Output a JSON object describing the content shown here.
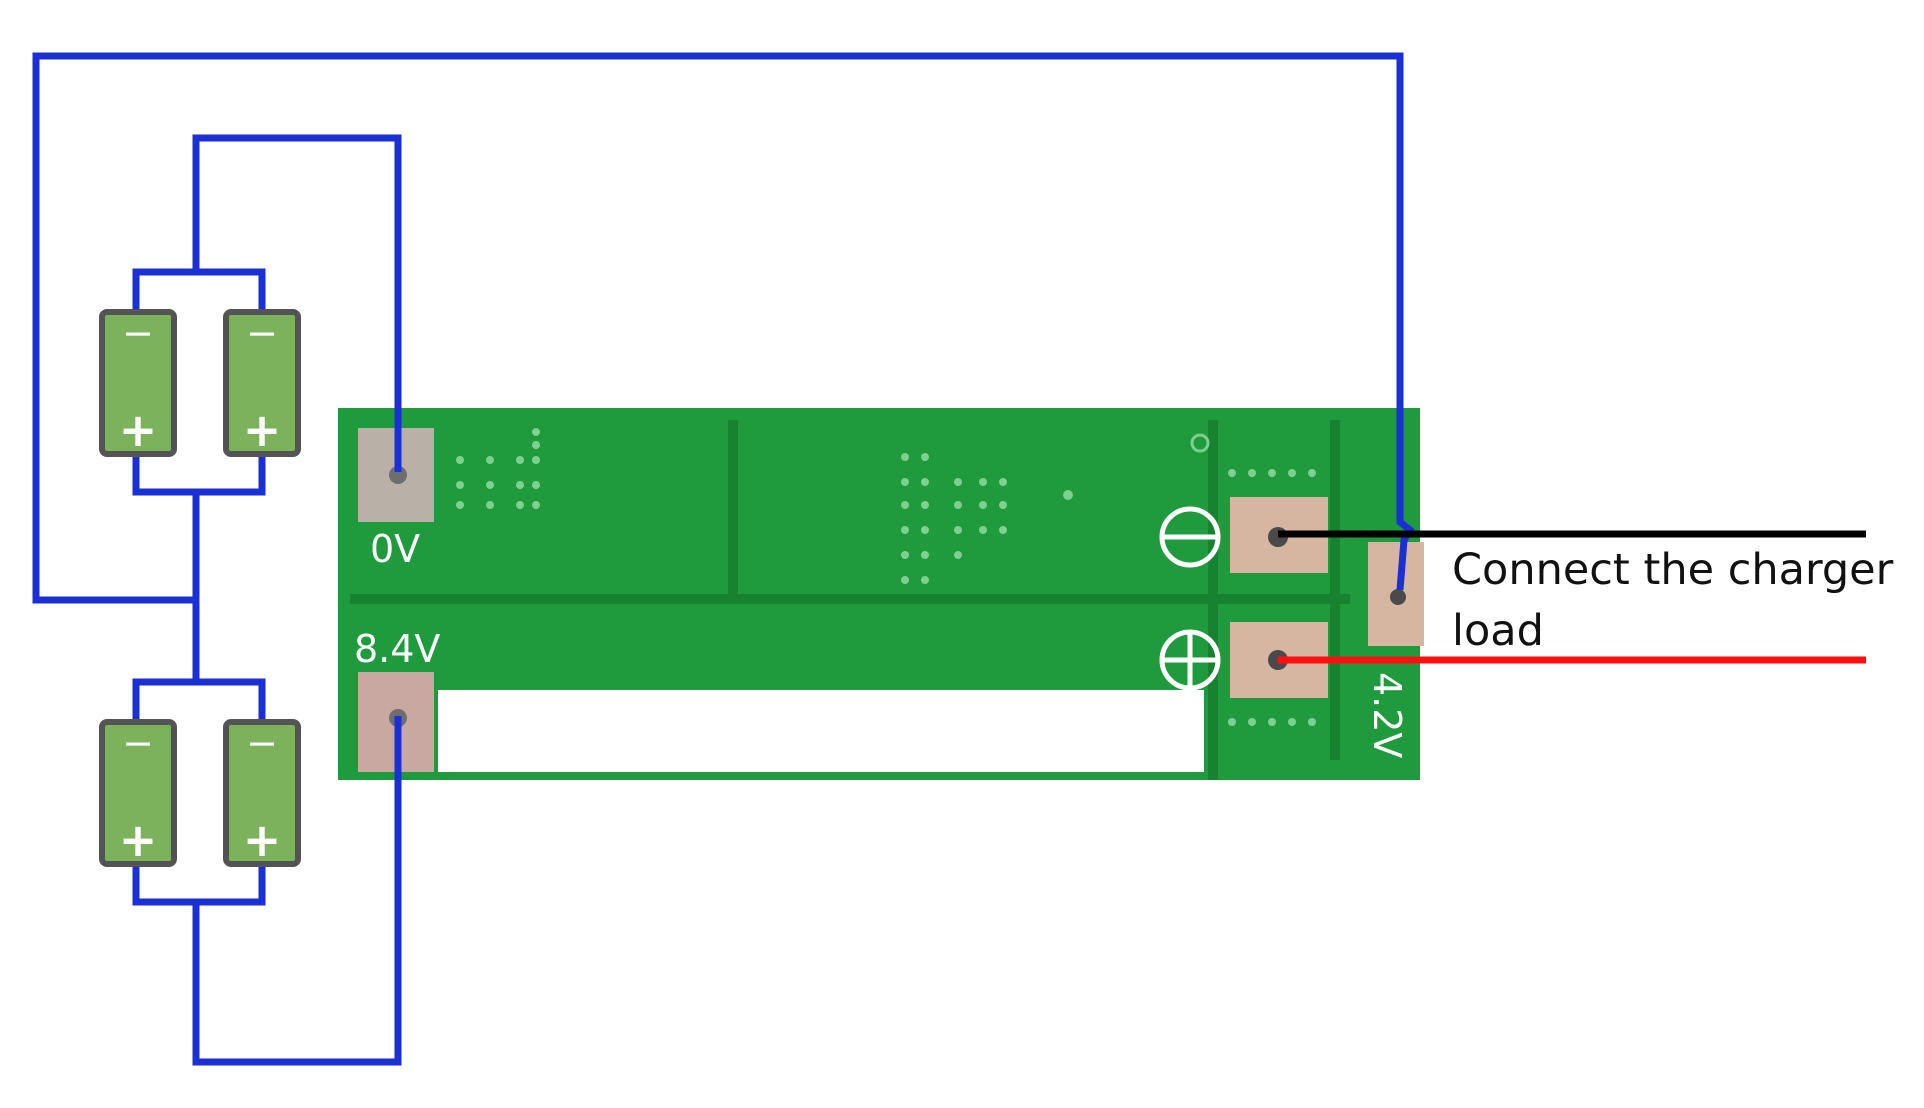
{
  "colors": {
    "wire": "#1a2fd4",
    "board": "#1f9a3c",
    "board_dark": "#17822f",
    "cell_fill": "#7db25c",
    "cell_border": "#545454",
    "pad": "#d6b6a0",
    "charger_negative": "#000000",
    "charger_positive": "#ff1010"
  },
  "board_labels": {
    "zero_volt": "0V",
    "eight_volt": "8.4V",
    "four_volt": "4.2V"
  },
  "charger_label": {
    "line1": "Connect the charger",
    "line2": "load"
  },
  "cell_groups": [
    {
      "cells": [
        {
          "negative": "−",
          "positive": "+"
        },
        {
          "negative": "−",
          "positive": "+"
        }
      ]
    },
    {
      "cells": [
        {
          "negative": "−",
          "positive": "+"
        },
        {
          "negative": "−",
          "positive": "+"
        }
      ]
    }
  ]
}
